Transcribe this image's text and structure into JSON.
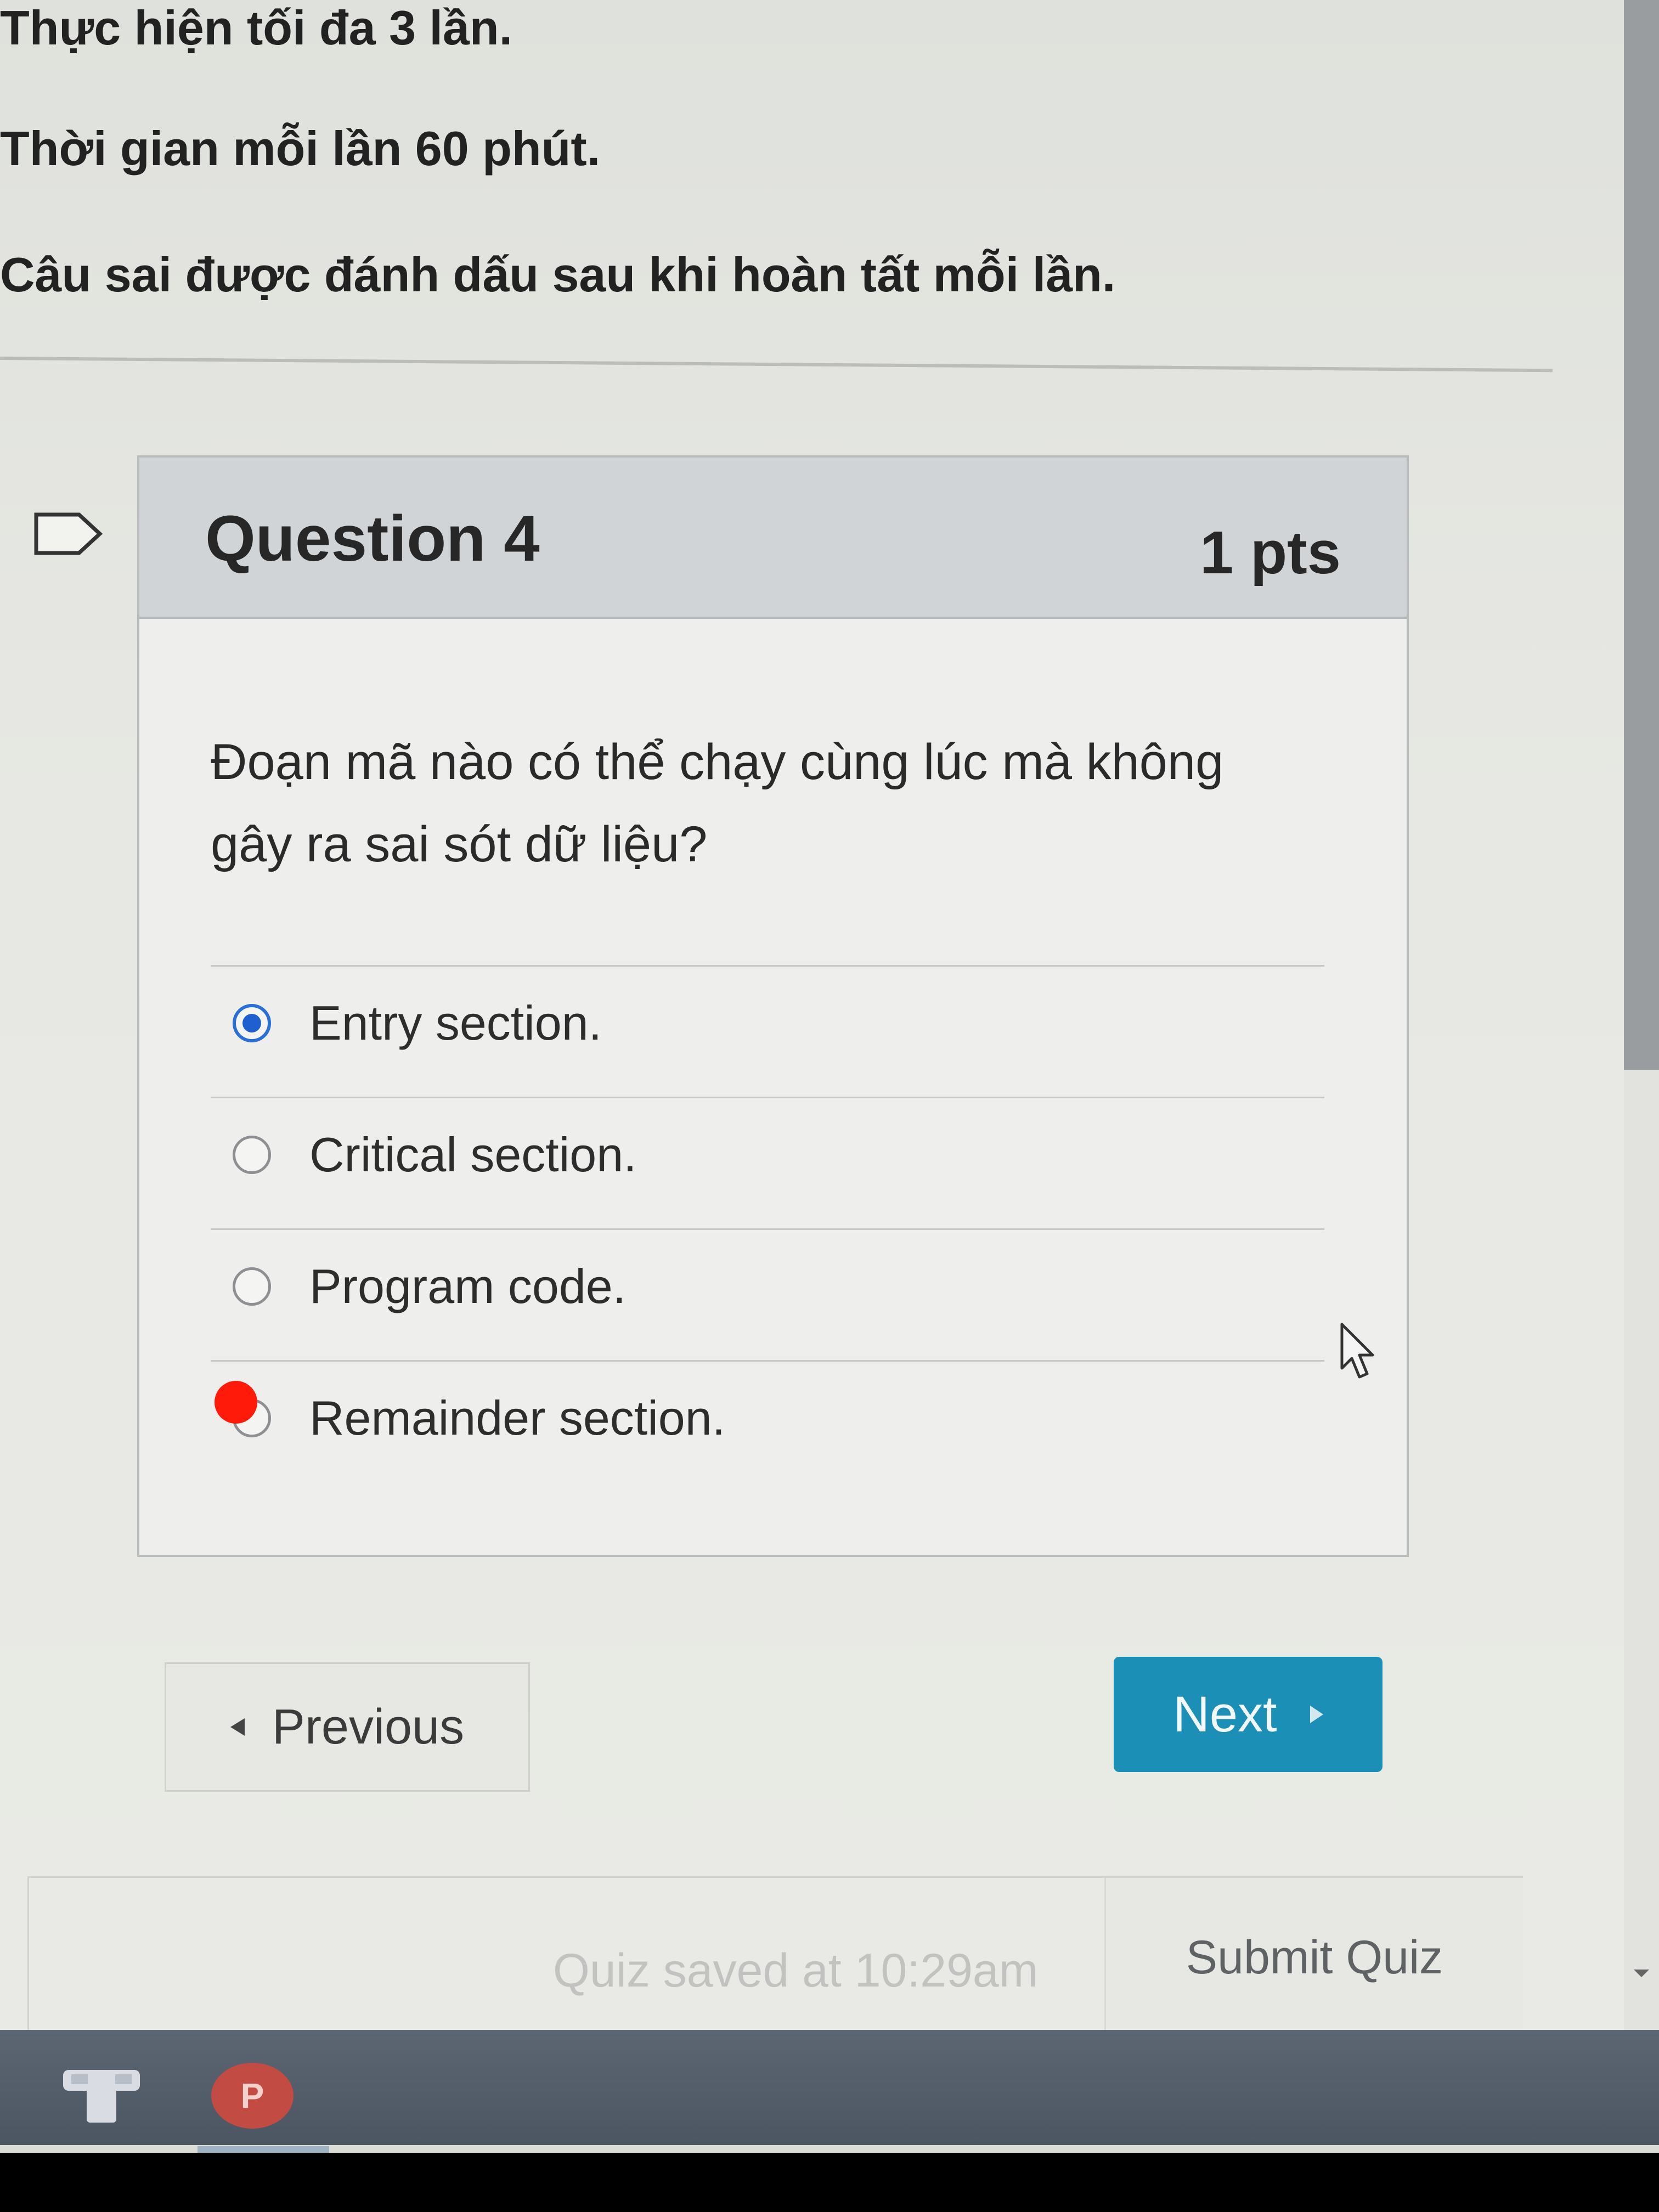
{
  "instructions": {
    "attempts": "Thực hiện tối đa 3 lần.",
    "time_limit": "Thời gian mỗi lần 60 phút.",
    "marking": "Câu sai được đánh dấu sau khi hoàn tất mỗi lần."
  },
  "question": {
    "title": "Question 4",
    "points": "1 pts",
    "text": "Đoạn mã nào có thể chạy cùng lúc mà không gây ra sai sót dữ liệu?",
    "answers": [
      {
        "label": "Entry section.",
        "selected": true
      },
      {
        "label": "Critical section.",
        "selected": false
      },
      {
        "label": "Program code.",
        "selected": false
      },
      {
        "label": "Remainder section.",
        "selected": false
      }
    ]
  },
  "navigation": {
    "previous_label": "Previous",
    "next_label": "Next"
  },
  "footer": {
    "saved_status": "Quiz saved at 10:29am",
    "submit_label": "Submit Quiz"
  },
  "taskbar": {
    "powerpoint_letter": "P"
  },
  "colors": {
    "accent": "#1c8fb7",
    "selected_radio": "#1f5fcf",
    "annotation_dot": "#ff1a0a"
  }
}
